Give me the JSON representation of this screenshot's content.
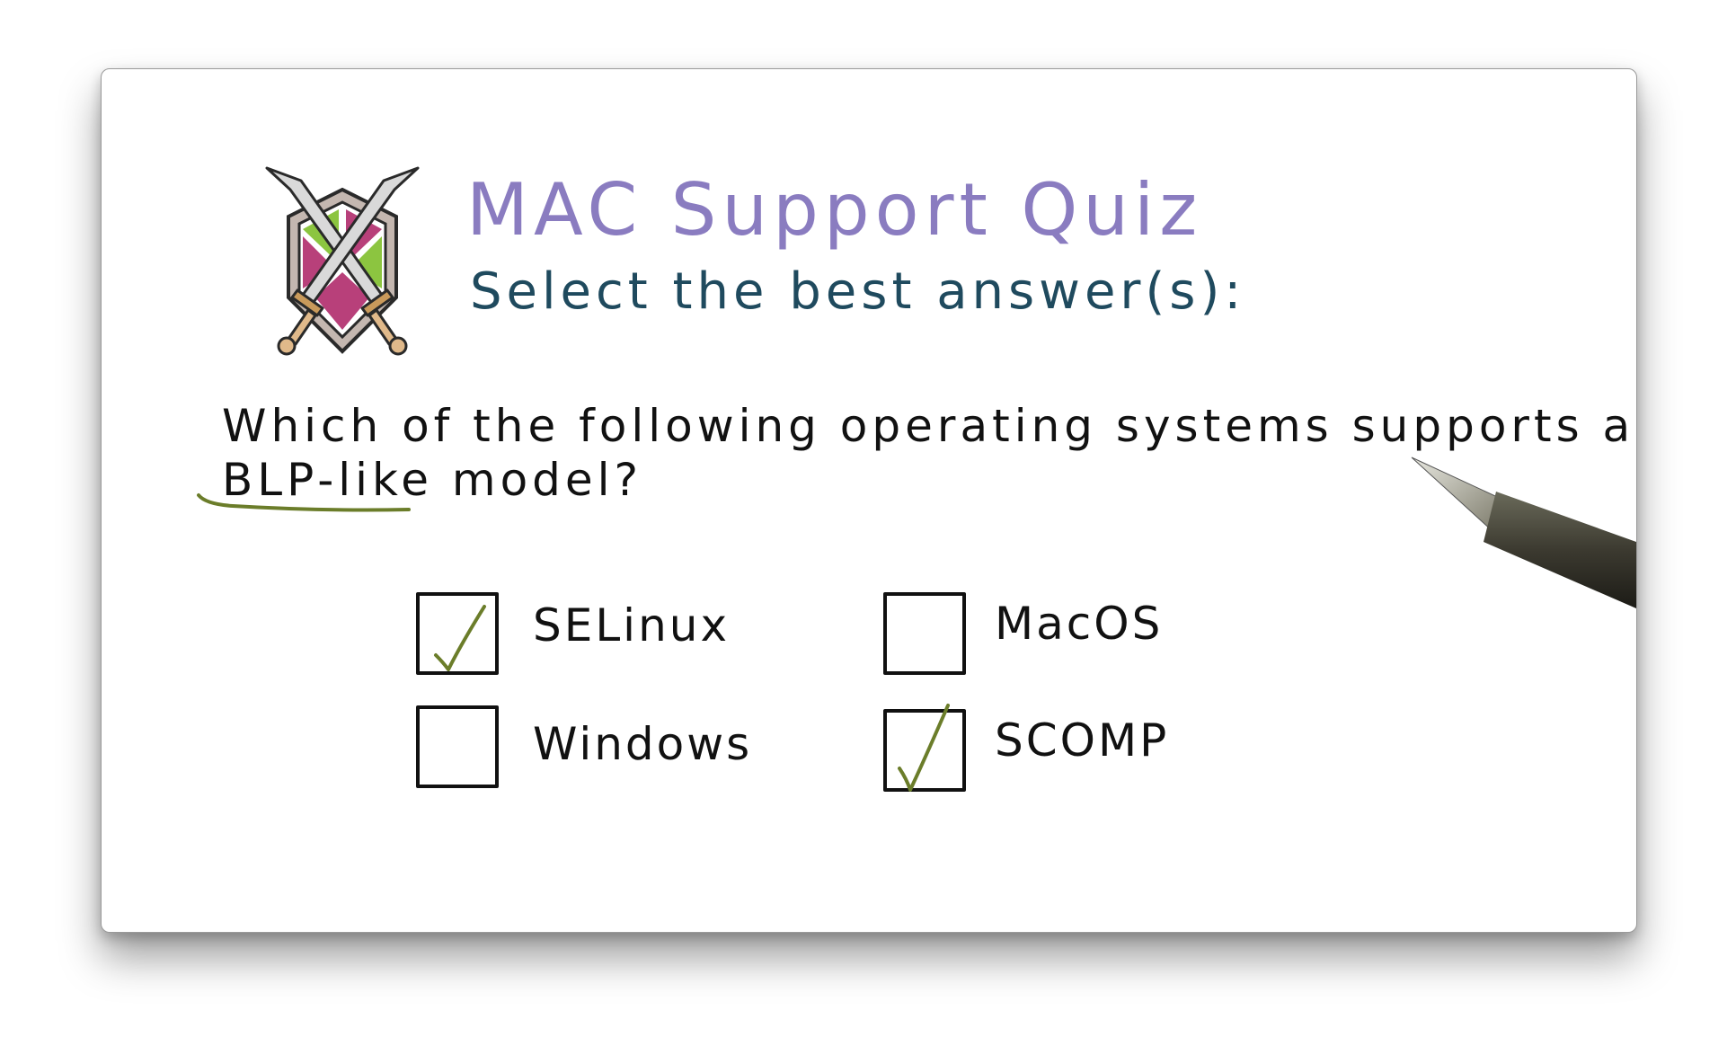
{
  "quiz": {
    "title": "MAC Support Quiz",
    "subtitle": "Select the best answer(s):",
    "question_line1": "Which of the following operating systems supports a",
    "question_line2": "BLP-like model?",
    "options": [
      {
        "label": "SELinux",
        "checked": true
      },
      {
        "label": "MacOS",
        "checked": false
      },
      {
        "label": "Windows",
        "checked": false
      },
      {
        "label": "SCOMP",
        "checked": true
      }
    ]
  },
  "colors": {
    "title": "#8a7cc0",
    "subtitle": "#1f4a5e",
    "check": "#6b7d2a",
    "underline": "#6b7d2a",
    "shield_green": "#8cc540",
    "shield_pink": "#b8407a"
  },
  "icons": {
    "logo": "crossed-swords-shield-icon",
    "check": "checkmark-icon",
    "pen": "pen-icon"
  }
}
